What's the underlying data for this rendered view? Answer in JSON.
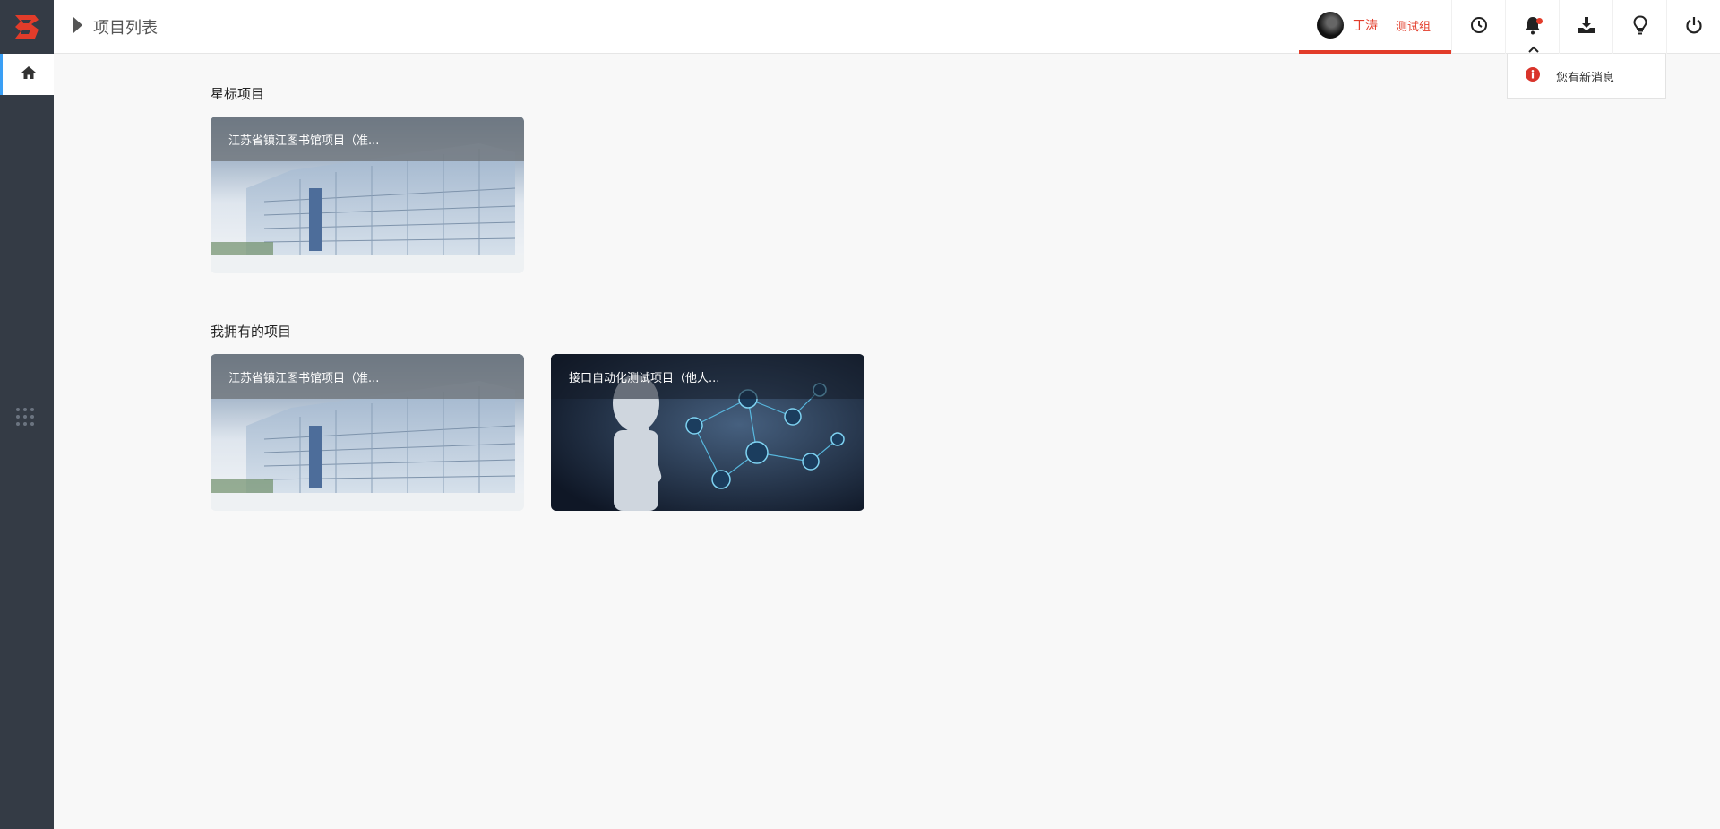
{
  "header": {
    "page_title": "项目列表",
    "user": {
      "name": "丁涛",
      "group": "测试组"
    }
  },
  "notification": {
    "text": "您有新消息"
  },
  "sections": {
    "starred": {
      "title": "星标项目",
      "cards": [
        {
          "title": "江苏省镇江图书馆项目（准..."
        }
      ]
    },
    "owned": {
      "title": "我拥有的项目",
      "cards": [
        {
          "title": "江苏省镇江图书馆项目（准..."
        },
        {
          "title": "接口自动化测试项目（他人..."
        }
      ]
    }
  },
  "icons": {
    "logo": "brand-logo-icon",
    "home": "home-icon",
    "apps": "apps-grid-icon",
    "breadcrumb": "caret-right-icon",
    "history": "clock-icon",
    "bell": "bell-icon",
    "download": "download-icon",
    "idea": "lightbulb-icon",
    "power": "power-icon",
    "info": "info-icon"
  },
  "colors": {
    "accent": "#e23c2a",
    "sidebar": "#343b45",
    "active": "#3a9ff5"
  }
}
